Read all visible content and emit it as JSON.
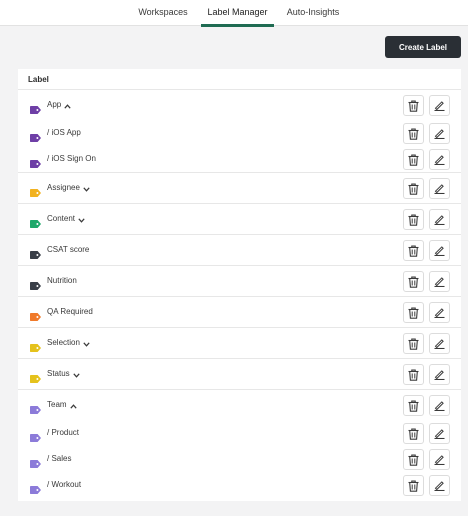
{
  "tabs": [
    {
      "label": "Workspaces",
      "active": false
    },
    {
      "label": "Label Manager",
      "active": true
    },
    {
      "label": "Auto-Insights",
      "active": false
    }
  ],
  "toolbar": {
    "create_label": "Create Label"
  },
  "table": {
    "column_header": "Label"
  },
  "labels": [
    {
      "name": "App",
      "color": "#6e3fa6",
      "expander": "up",
      "child": false
    },
    {
      "name": "/ iOS App",
      "color": "#6e3fa6",
      "expander": "",
      "child": true
    },
    {
      "name": "/ iOS Sign On",
      "color": "#6e3fa6",
      "expander": "",
      "child": true
    },
    {
      "name": "Assignee",
      "color": "#f2b21f",
      "expander": "down",
      "child": false
    },
    {
      "name": "Content",
      "color": "#1ea86a",
      "expander": "down",
      "child": false
    },
    {
      "name": "CSAT score",
      "color": "#3a3f48",
      "expander": "",
      "child": false
    },
    {
      "name": "Nutrition",
      "color": "#3a3f48",
      "expander": "",
      "child": false
    },
    {
      "name": "QA Required",
      "color": "#f07a2a",
      "expander": "",
      "child": false
    },
    {
      "name": "Selection",
      "color": "#e5c21c",
      "expander": "down",
      "child": false
    },
    {
      "name": "Status",
      "color": "#e5c21c",
      "expander": "down",
      "child": false
    },
    {
      "name": "Team",
      "color": "#8c7bd9",
      "expander": "up",
      "child": false
    },
    {
      "name": "/ Product",
      "color": "#8c7bd9",
      "expander": "",
      "child": true
    },
    {
      "name": "/ Sales",
      "color": "#8c7bd9",
      "expander": "",
      "child": true
    },
    {
      "name": "/ Workout",
      "color": "#8c7bd9",
      "expander": "",
      "child": true
    }
  ],
  "icons": {
    "tag": "tag-icon",
    "delete": "trash-icon",
    "edit": "pencil-icon",
    "expand": "chevron-icon"
  }
}
